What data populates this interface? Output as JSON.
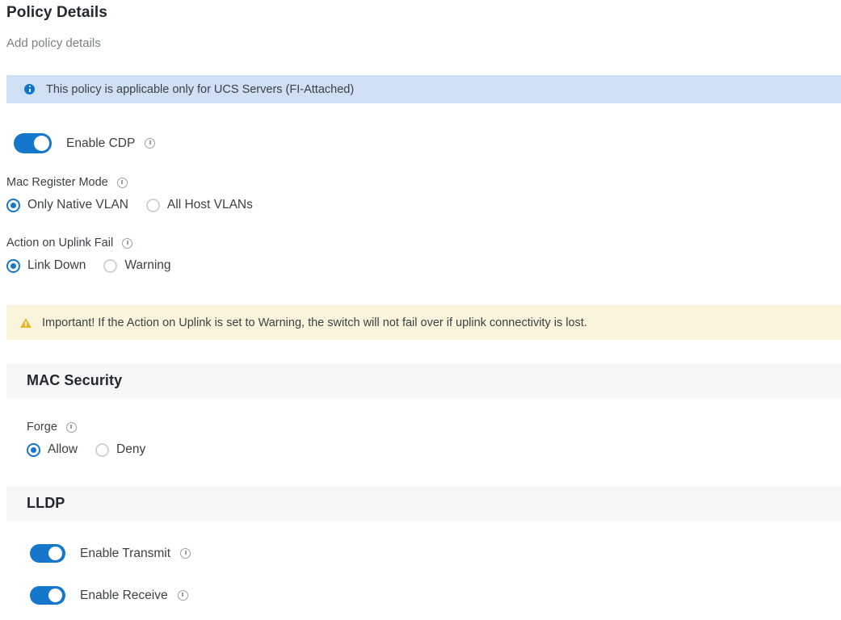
{
  "header": {
    "title": "Policy Details",
    "subtitle": "Add policy details"
  },
  "info_banner": {
    "icon": "info-circle-icon",
    "text": "This policy is applicable only for UCS Servers (FI-Attached)",
    "background": "#cfe0f4",
    "icon_color": "#1075c8"
  },
  "warning_banner": {
    "icon": "warning-triangle-icon",
    "text": "Important! If the Action on Uplink is set to Warning, the switch will not fail over if uplink connectivity is lost.",
    "background": "#faf4dc",
    "icon_color": "#e8b52b"
  },
  "cdp": {
    "label": "Enable CDP",
    "enabled": true,
    "help_icon": "help-info-icon"
  },
  "mac_register_mode": {
    "label": "Mac Register Mode",
    "help_icon": "help-info-icon",
    "options": [
      {
        "label": "Only Native VLAN",
        "checked": true
      },
      {
        "label": "All Host VLANs",
        "checked": false
      }
    ]
  },
  "action_on_uplink_fail": {
    "label": "Action on Uplink Fail",
    "help_icon": "help-info-icon",
    "options": [
      {
        "label": "Link Down",
        "checked": true
      },
      {
        "label": "Warning",
        "checked": false
      }
    ]
  },
  "mac_security": {
    "section_title": "MAC Security",
    "forge": {
      "label": "Forge",
      "help_icon": "help-info-icon",
      "options": [
        {
          "label": "Allow",
          "checked": true
        },
        {
          "label": "Deny",
          "checked": false
        }
      ]
    }
  },
  "lldp": {
    "section_title": "LLDP",
    "toggles": [
      {
        "label": "Enable Transmit",
        "enabled": true,
        "help_icon": "help-info-icon"
      },
      {
        "label": "Enable Receive",
        "enabled": true,
        "help_icon": "help-info-icon"
      }
    ]
  },
  "colors": {
    "accent": "#1577cb",
    "text": "#3c4146",
    "heading": "#23282e",
    "muted": "#7b8087",
    "band": "#f6f6f7"
  }
}
